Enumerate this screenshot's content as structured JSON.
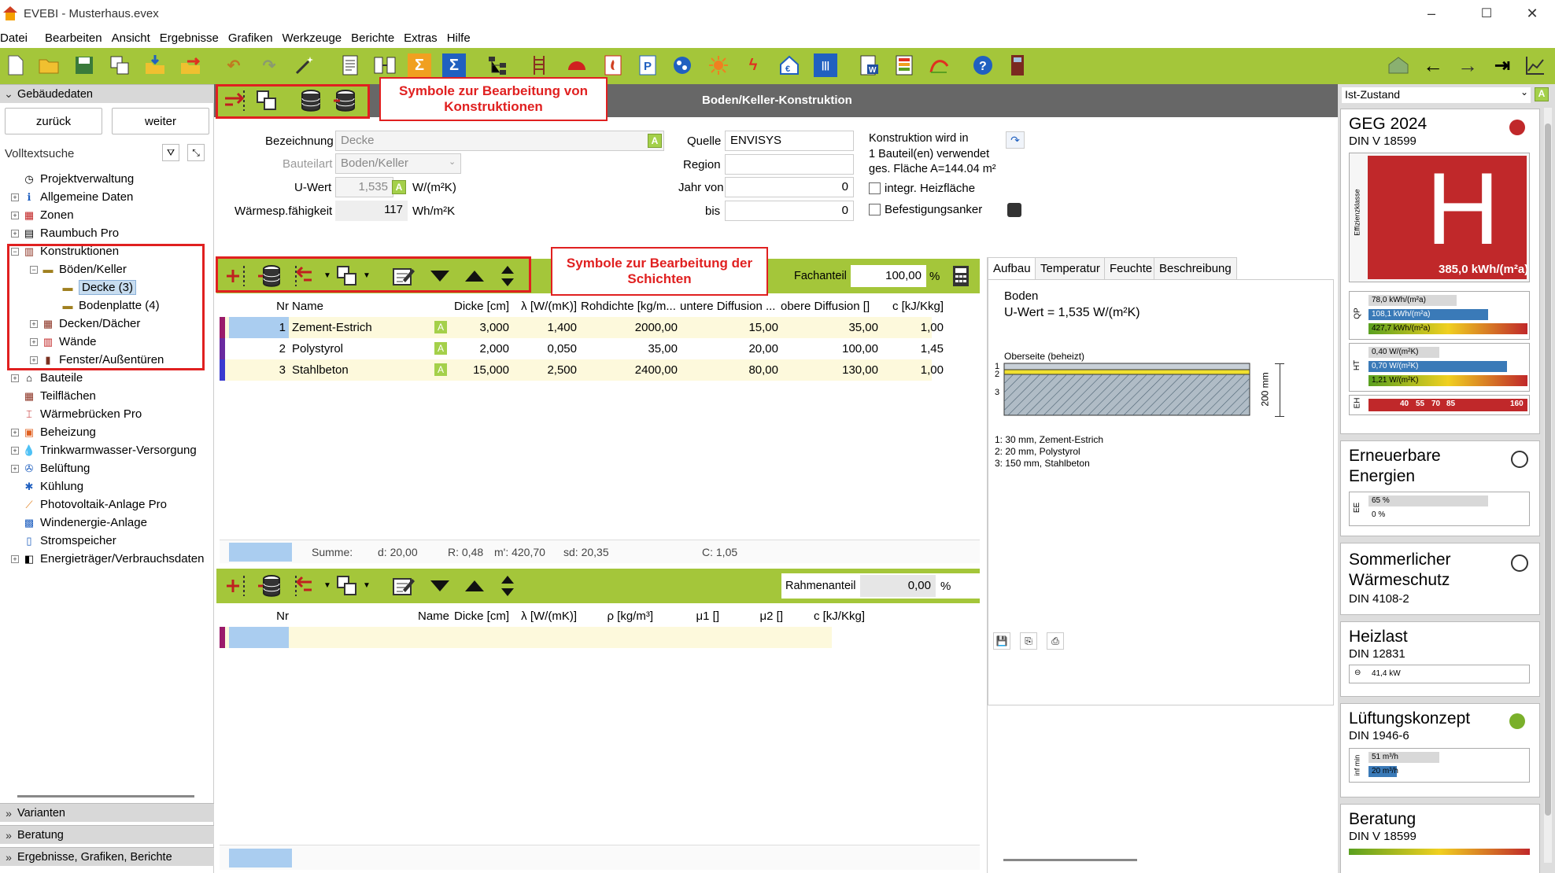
{
  "window": {
    "title": "EVEBI - Musterhaus.evex",
    "controls": [
      "–",
      "☐",
      "✕"
    ]
  },
  "menu": [
    "Datei",
    "Bearbeiten",
    "Ansicht",
    "Ergebnisse",
    "Grafiken",
    "Werkzeuge",
    "Berichte",
    "Extras",
    "Hilfe"
  ],
  "colors": {
    "accent_green": "#a4c63a",
    "header_grey": "#676767",
    "annotation_red": "#e02020",
    "selection_blue": "#aacdf0",
    "energy_red": "#c0282a"
  },
  "left": {
    "section_title": "Gebäudedaten",
    "back_label": "zurück",
    "next_label": "weiter",
    "search_label": "Volltextsuche",
    "tree": [
      {
        "label": "Projektverwaltung",
        "icon": "clock-icon"
      },
      {
        "label": "Allgemeine Daten",
        "icon": "info-icon"
      },
      {
        "label": "Zonen",
        "icon": "zones-icon"
      },
      {
        "label": "Raumbuch Pro",
        "icon": "book-icon"
      },
      {
        "label": "Konstruktionen",
        "icon": "construction-icon"
      },
      {
        "label": "Böden/Keller",
        "icon": "floor-icon"
      },
      {
        "label": "Decke (3)",
        "icon": "layer-icon"
      },
      {
        "label": "Bodenplatte (4)",
        "icon": "layer-icon"
      },
      {
        "label": "Decken/Dächer",
        "icon": "roof-icon"
      },
      {
        "label": "Wände",
        "icon": "wall-icon"
      },
      {
        "label": "Fenster/Außentüren",
        "icon": "door-icon"
      },
      {
        "label": "Bauteile",
        "icon": "folder-icon"
      },
      {
        "label": "Teilflächen",
        "icon": "parts-icon"
      },
      {
        "label": "Wärmebrücken Pro",
        "icon": "bridge-icon"
      },
      {
        "label": "Beheizung",
        "icon": "heating-icon"
      },
      {
        "label": "Trinkwarmwasser-Versorgung",
        "icon": "water-drop-icon"
      },
      {
        "label": "Belüftung",
        "icon": "fan-icon"
      },
      {
        "label": "Kühlung",
        "icon": "snowflake-icon"
      },
      {
        "label": "Photovoltaik-Anlage Pro",
        "icon": "solar-icon"
      },
      {
        "label": "Windenergie-Anlage",
        "icon": "wind-icon"
      },
      {
        "label": "Stromspeicher",
        "icon": "battery-icon"
      },
      {
        "label": "Energieträger/Verbrauchsdaten",
        "icon": "energy-icon"
      }
    ],
    "bottom_sections": [
      "Varianten",
      "Beratung",
      "Ergebnisse, Grafiken, Berichte"
    ]
  },
  "annotations": {
    "constructions": "Symbole zur Bearbeitung von Konstruktionen",
    "layers": "Symbole zur Bearbeitung der Schichten"
  },
  "center": {
    "header_title": "Boden/Keller-Konstruktion",
    "form": {
      "bezeichnung_label": "Bezeichnung",
      "bezeichnung_value": "Decke",
      "bauteilart_label": "Bauteilart",
      "bauteilart_value": "Boden/Keller",
      "uwert_label": "U-Wert",
      "uwert_value": "1,535",
      "uwert_unit": "W/(m²K)",
      "waerme_label": "Wärmesp.fähigkeit",
      "waerme_value": "117",
      "waerme_unit": "Wh/m²K",
      "quelle_label": "Quelle",
      "quelle_value": "ENVISYS",
      "region_label": "Region",
      "region_value": "",
      "jahrvon_label": "Jahr von",
      "jahrvon_value": "0",
      "bis_label": "bis",
      "bis_value": "0",
      "usage_line1": "Konstruktion wird in",
      "usage_line2": "1 Bauteil(en) verwendet",
      "usage_line3": "ges. Fläche A=144.04 m²",
      "heizflaeche_label": "integr. Heizfläche",
      "anker_label": "Befestigungsanker",
      "badge": "A"
    },
    "layers": {
      "fachanteil_label": "Fachanteil",
      "fachanteil_value": "100,00",
      "percent": "%",
      "headers": [
        "Nr",
        "Name",
        "Dicke [cm]",
        "λ [W/(mK)]",
        "Rohdichte [kg/m...",
        "untere Diffusion ...",
        "obere Diffusion []",
        "c [kJ/Kkg]"
      ],
      "rows": [
        {
          "nr": "1",
          "name": "Zement-Estrich",
          "dicke": "3,000",
          "lambda": "1,400",
          "dichte": "2000,00",
          "unten": "15,00",
          "oben": "35,00",
          "c": "1,00",
          "color": "#9a1a6a"
        },
        {
          "nr": "2",
          "name": "Polystyrol",
          "dicke": "2,000",
          "lambda": "0,050",
          "dichte": "35,00",
          "unten": "20,00",
          "oben": "100,00",
          "c": "1,45",
          "color": "#6a2aa0"
        },
        {
          "nr": "3",
          "name": "Stahlbeton",
          "dicke": "15,000",
          "lambda": "2,500",
          "dichte": "2400,00",
          "unten": "80,00",
          "oben": "130,00",
          "c": "1,00",
          "color": "#3a3ad0"
        }
      ],
      "sum": {
        "label": "Summe:",
        "d": "d: 20,00",
        "r": "R: 0,48",
        "m": "m': 420,70",
        "sd": "sd: 20,35",
        "c": "C: 1,05"
      }
    },
    "frame": {
      "rahmen_label": "Rahmenanteil",
      "rahmen_value": "0,00",
      "percent": "%",
      "headers": [
        "Nr",
        "Name",
        "Dicke [cm]",
        "λ [W/(mK)]",
        "ρ [kg/m³]",
        "μ1 []",
        "μ2 []",
        "c [kJ/Kkg]"
      ]
    }
  },
  "preview": {
    "tabs": [
      "Aufbau",
      "Temperatur",
      "Feuchte",
      "Beschreibung"
    ],
    "title": "Boden",
    "uwert": "U-Wert = 1,535 W/(m²K)",
    "top_label": "Oberseite (beheizt)",
    "dim_label": "200 mm",
    "layer_numbers": [
      "1",
      "2",
      "3"
    ],
    "legend": [
      "1:  30 mm, Zement-Estrich",
      "2:  20 mm, Polystyrol",
      "3:  150 mm, Stahlbeton"
    ]
  },
  "right": {
    "dropdown": "Ist-Zustand",
    "geg": {
      "title": "GEG 2024",
      "subtitle": "DIN V 18599",
      "class_letter": "H",
      "value": "385,0 kWh/(m²a)",
      "axis_label": "Effizienzklasse",
      "status_color": "#c0282a",
      "qp": [
        "78,0 kWh/(m²a)",
        "108,1 kWh/(m²a)",
        "427,7 kWh/(m²a)"
      ],
      "ht": [
        "0,40 W/(m²K)",
        "0,70 W/(m²K)",
        "1,21 W/(m²K)"
      ],
      "eh": [
        "40",
        "55",
        "70",
        "85",
        "160"
      ],
      "qp_label": "QP",
      "ht_label": "HT",
      "eh_label": "EH"
    },
    "ee": {
      "title1": "Erneuerbare",
      "title2": "Energien",
      "values": [
        "65 %",
        "0 %"
      ],
      "label": "EE"
    },
    "sommer": {
      "title1": "Sommerlicher",
      "title2": "Wärmeschutz",
      "subtitle": "DIN 4108-2"
    },
    "heizlast": {
      "title": "Heizlast",
      "subtitle": "DIN 12831",
      "value": "41,4 kW"
    },
    "lueftung": {
      "title": "Lüftungskonzept",
      "subtitle": "DIN 1946-6",
      "values": [
        "51 m³/h",
        "20 m³/h"
      ],
      "label": "inf min",
      "status_color": "#7ab02a"
    },
    "beratung": {
      "title": "Beratung",
      "subtitle": "DIN V 18599"
    }
  }
}
